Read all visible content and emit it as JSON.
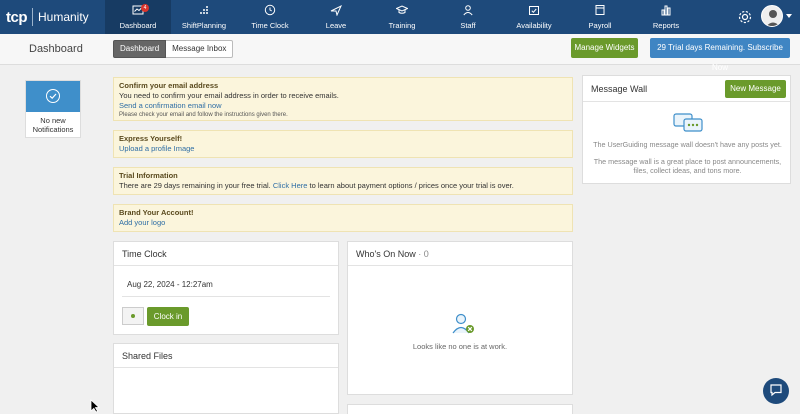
{
  "brand": {
    "tcp": "tcp",
    "name": "Humanity"
  },
  "nav": [
    {
      "label": "Dashboard",
      "icon": "dashboard-icon",
      "badge": "4"
    },
    {
      "label": "ShiftPlanning",
      "icon": "shiftplanning-icon"
    },
    {
      "label": "Time Clock",
      "icon": "clock-icon"
    },
    {
      "label": "Leave",
      "icon": "plane-icon"
    },
    {
      "label": "Training",
      "icon": "graduation-cap-icon"
    },
    {
      "label": "Staff",
      "icon": "person-icon"
    },
    {
      "label": "Availability",
      "icon": "calendar-check-icon"
    },
    {
      "label": "Payroll",
      "icon": "payroll-icon"
    },
    {
      "label": "Reports",
      "icon": "bar-chart-icon"
    }
  ],
  "subheader": {
    "title": "Dashboard",
    "tabs": [
      "Dashboard",
      "Message Inbox"
    ],
    "manage_widgets": "Manage Widgets",
    "trial": "29 Trial days Remaining. Subscribe Now"
  },
  "notifications": {
    "text": "No new Notifications"
  },
  "alerts": {
    "email": {
      "title": "Confirm your email address",
      "body": "You need to confirm your email address in order to receive emails.",
      "link": "Send a confirmation email now",
      "note": "Please check your email and follow the instructions given there."
    },
    "express": {
      "title": "Express Yourself!",
      "link": "Upload a profile Image"
    },
    "trial": {
      "title": "Trial Information",
      "body_before": "There are 29 days remaining in your free trial.",
      "link": "Click Here",
      "body_after": "to learn about payment options / prices once your trial is over."
    },
    "brand": {
      "title": "Brand Your Account!",
      "link": "Add your logo"
    }
  },
  "message_wall": {
    "title": "Message Wall",
    "new_button": "New Message",
    "empty": "The UserGuiding message wall doesn't have any posts yet.",
    "hint": "The message wall is a great place to post announcements, files, collect ideas, and tons more."
  },
  "time_clock": {
    "title": "Time Clock",
    "datetime": "Aug 22, 2024 - 12:27am",
    "clock_in": "Clock in"
  },
  "whos_on": {
    "title": "Who's On Now",
    "count": "· 0",
    "empty": "Looks like no one is at work."
  },
  "shared_files": {
    "title": "Shared Files"
  },
  "colors": {
    "nav": "#1e4a7b",
    "green": "#6a9a2b",
    "blue": "#3f85c3",
    "alert_bg": "#fbf5dc"
  }
}
